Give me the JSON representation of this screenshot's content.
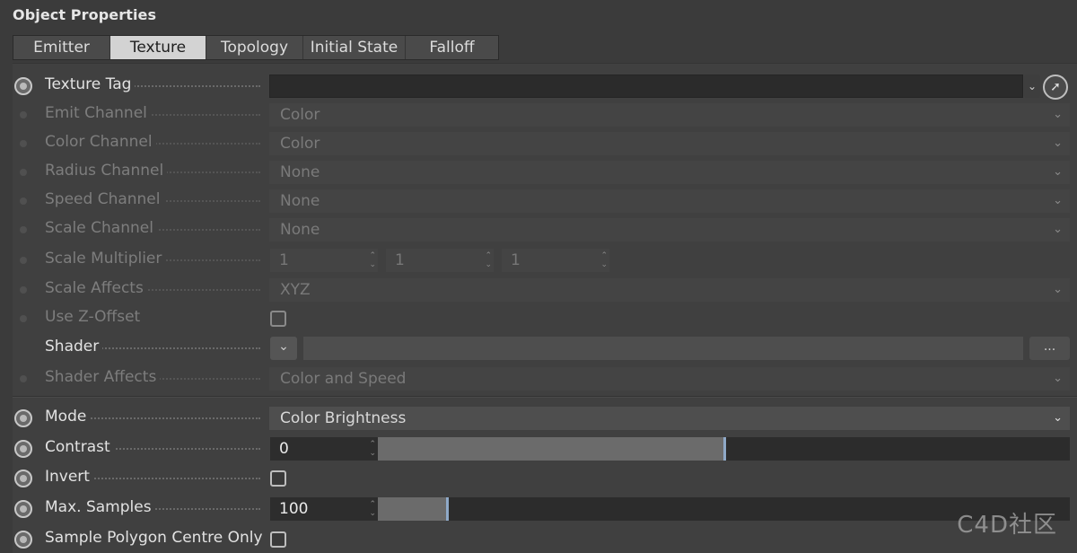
{
  "panel": {
    "title": "Object Properties"
  },
  "tabs": [
    {
      "label": "Emitter",
      "active": false
    },
    {
      "label": "Texture",
      "active": true
    },
    {
      "label": "Topology",
      "active": false
    },
    {
      "label": "Initial State",
      "active": false
    },
    {
      "label": "Falloff",
      "active": false
    }
  ],
  "rows": {
    "texture_tag": {
      "label": "Texture Tag",
      "value": ""
    },
    "emit_channel": {
      "label": "Emit Channel",
      "value": "Color"
    },
    "color_channel": {
      "label": "Color Channel",
      "value": "Color"
    },
    "radius_channel": {
      "label": "Radius Channel",
      "value": "None"
    },
    "speed_channel": {
      "label": "Speed Channel",
      "value": "None"
    },
    "scale_channel": {
      "label": "Scale Channel",
      "value": "None"
    },
    "scale_multiplier": {
      "label": "Scale Multiplier",
      "values": [
        "1",
        "1",
        "1"
      ]
    },
    "scale_affects": {
      "label": "Scale Affects",
      "value": "XYZ"
    },
    "use_z_offset": {
      "label": "Use Z-Offset",
      "checked": false
    },
    "shader": {
      "label": "Shader",
      "value": "",
      "more_label": "..."
    },
    "shader_affects": {
      "label": "Shader Affects",
      "value": "Color and Speed"
    },
    "mode": {
      "label": "Mode",
      "value": "Color Brightness"
    },
    "contrast": {
      "label": "Contrast",
      "value": "0",
      "slider_fraction": 0.5
    },
    "invert": {
      "label": "Invert",
      "checked": false
    },
    "max_samples": {
      "label": "Max. Samples",
      "value": "100",
      "slider_fraction": 0.1
    },
    "sample_polygon": {
      "label": "Sample Polygon Centre Only",
      "checked": false
    }
  },
  "icons": {
    "dropdown": "chevron-down-icon",
    "pick": "pick-cursor-icon",
    "spinner": "spinner-arrows-icon"
  },
  "colors": {
    "slider_knob": "#8fa9c8",
    "active_tab": "#d3d3d3"
  },
  "watermark": "C4D社区"
}
